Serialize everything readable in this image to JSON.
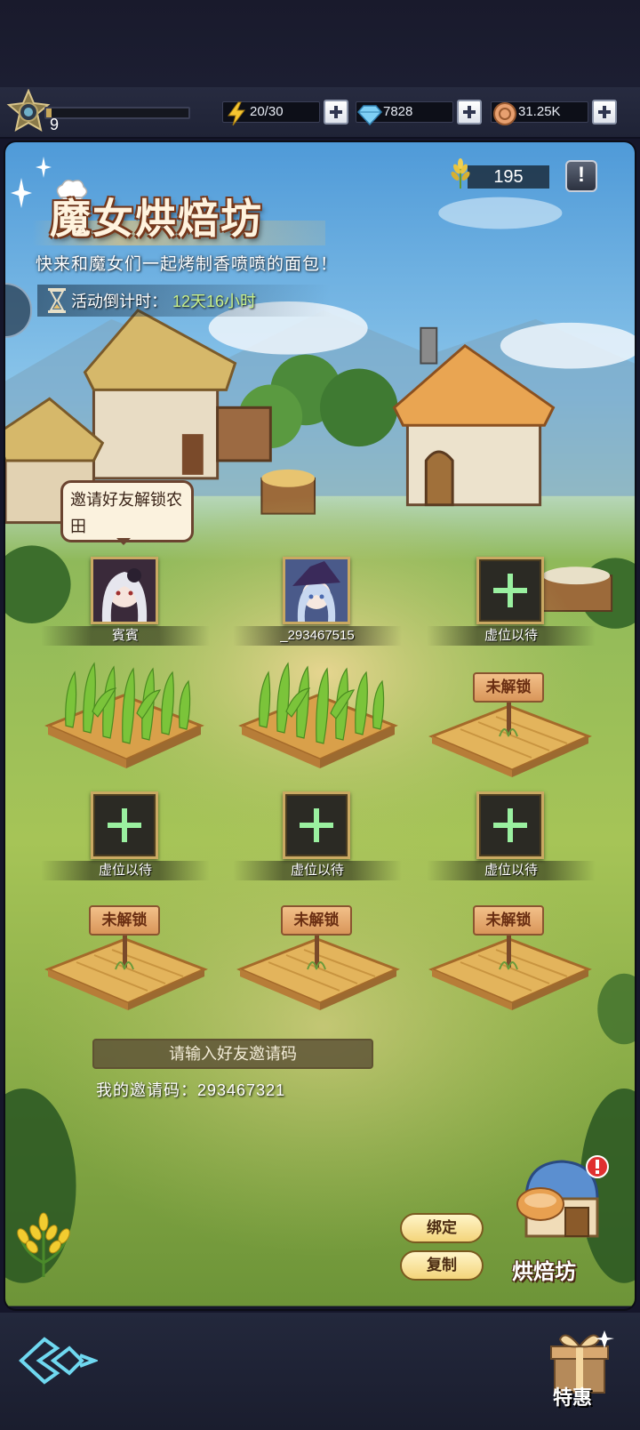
{
  "topbar": {
    "level": "9",
    "xp_progress": 0.04,
    "energy": "20/30",
    "diamonds": "7828",
    "coins": "31.25K"
  },
  "event": {
    "title": "魔女烘焙坊",
    "subtitle": "快来和魔女们一起烤制香喷喷的面包！",
    "countdown_label": "活动倒计时：",
    "countdown_value": "12天16小时",
    "wheat_count": "195",
    "info_glyph": "!"
  },
  "bubble_text": "邀请好友解锁农田",
  "slots": [
    {
      "name": "賓賓",
      "type": "avatar"
    },
    {
      "name": "_293467515",
      "type": "avatar"
    },
    {
      "name": "虚位以待",
      "type": "empty"
    },
    {
      "name": "虚位以待",
      "type": "empty"
    },
    {
      "name": "虚位以待",
      "type": "empty"
    },
    {
      "name": "虚位以待",
      "type": "empty"
    }
  ],
  "locked_label": "未解锁",
  "invite": {
    "placeholder": "请输入好友邀请码",
    "my_code_label": "我的邀请码：",
    "my_code": "293467321",
    "bind_button": "绑定",
    "copy_button": "复制"
  },
  "bakery_button": "烘焙坊",
  "promo_label": "特惠",
  "colors": {
    "accent_gold": "#c9a962",
    "countdown_green": "#c9f08a",
    "sign_wood": "#d9965a"
  }
}
